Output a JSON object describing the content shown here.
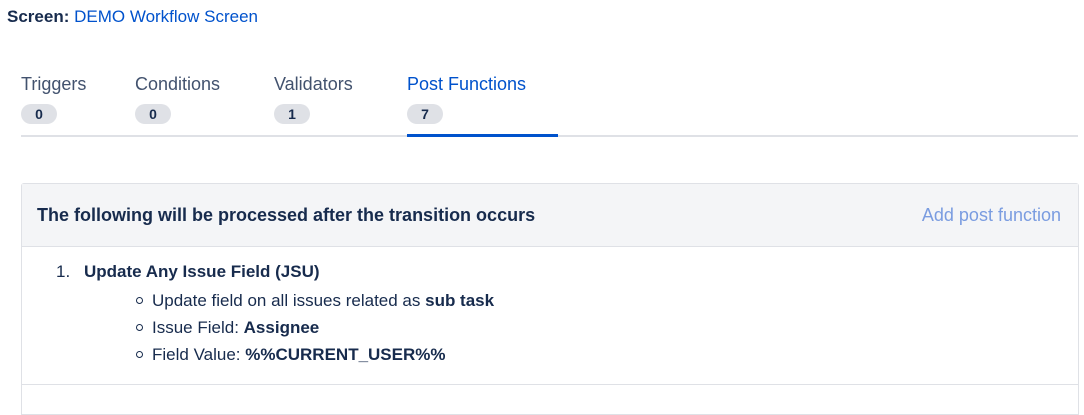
{
  "screen": {
    "label": "Screen",
    "separator": ":",
    "link": "DEMO Workflow Screen"
  },
  "tabs": [
    {
      "name": "Triggers",
      "count": "0"
    },
    {
      "name": "Conditions",
      "count": "0"
    },
    {
      "name": "Validators",
      "count": "1"
    },
    {
      "name": "Post Functions",
      "count": "7",
      "active": true
    }
  ],
  "panel": {
    "title": "The following will be processed after the transition occurs",
    "add_link": "Add post function",
    "functions": [
      {
        "num": "1.",
        "title": "Update Any Issue Field (JSU)",
        "details": [
          {
            "text": "Update field on all issues related as ",
            "bold": "sub task"
          },
          {
            "text": "Issue Field: ",
            "bold": "Assignee"
          },
          {
            "text": "Field Value: ",
            "bold": "%%CURRENT_USER%%"
          }
        ]
      }
    ]
  },
  "colors": {
    "link": "#0052cc",
    "muted_link": "#7a9ce0",
    "text": "#172b4d"
  }
}
